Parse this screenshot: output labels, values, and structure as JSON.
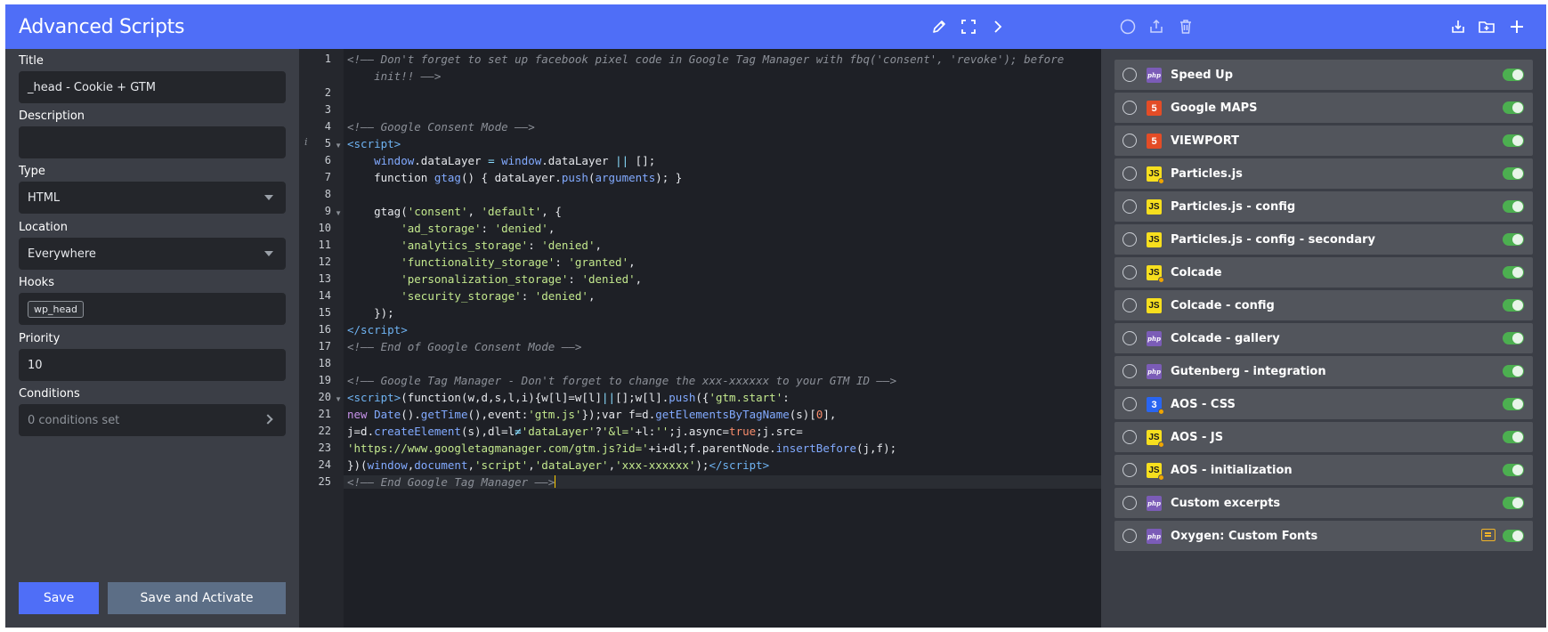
{
  "left": {
    "title": "Advanced Scripts",
    "fields": {
      "title_label": "Title",
      "title_value": "_head - Cookie + GTM",
      "description_label": "Description",
      "description_value": "",
      "type_label": "Type",
      "type_value": "HTML",
      "location_label": "Location",
      "location_value": "Everywhere",
      "hooks_label": "Hooks",
      "hooks_chip": "wp_head",
      "priority_label": "Priority",
      "priority_value": "10",
      "conditions_label": "Conditions",
      "conditions_value": "0 conditions set"
    },
    "buttons": {
      "save": "Save",
      "save_activate": "Save and Activate"
    }
  },
  "editor": {
    "line_numbers": [
      "1",
      "2",
      "3",
      "4",
      "5",
      "6",
      "7",
      "8",
      "9",
      "10",
      "11",
      "12",
      "13",
      "14",
      "15",
      "16",
      "17",
      "18",
      "19",
      "20",
      "21",
      "22",
      "23",
      "24",
      "25"
    ]
  },
  "right": {
    "scripts": [
      {
        "name": "Speed Up",
        "type": "php"
      },
      {
        "name": "Google MAPS",
        "type": "html"
      },
      {
        "name": "VIEWPORT",
        "type": "html"
      },
      {
        "name": "Particles.js",
        "type": "js",
        "dot": true
      },
      {
        "name": "Particles.js - config",
        "type": "js"
      },
      {
        "name": "Particles.js - config - secondary",
        "type": "js"
      },
      {
        "name": "Colcade",
        "type": "js",
        "dot": true
      },
      {
        "name": "Colcade - config",
        "type": "js"
      },
      {
        "name": "Colcade - gallery",
        "type": "php"
      },
      {
        "name": "Gutenberg - integration",
        "type": "php"
      },
      {
        "name": "AOS - CSS",
        "type": "css",
        "dot": true
      },
      {
        "name": "AOS - JS",
        "type": "js",
        "dot": true
      },
      {
        "name": "AOS - initialization",
        "type": "js",
        "dot": true
      },
      {
        "name": "Custom excerpts",
        "type": "php"
      },
      {
        "name": "Oxygen: Custom Fonts",
        "type": "php",
        "note": true
      }
    ]
  },
  "colors": {
    "accent": "#4f6ef7",
    "toggle_on": "#4caf50",
    "panel": "#3b3e46",
    "editor_bg": "#1e2026"
  }
}
